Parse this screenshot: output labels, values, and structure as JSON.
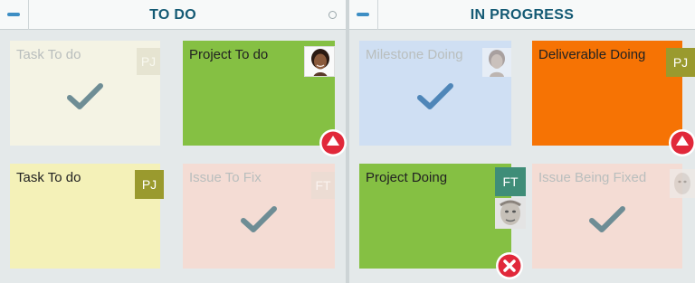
{
  "columns": [
    {
      "title": "TO DO"
    },
    {
      "title": "IN PROGRESS"
    }
  ],
  "cards": [
    {
      "title": "Task To do",
      "badge": "PJ"
    },
    {
      "title": "Project To do"
    },
    {
      "title": "Task To do",
      "badge": "PJ"
    },
    {
      "title": "Issue To Fix",
      "badge": "FT"
    },
    {
      "title": "Milestone Doing"
    },
    {
      "title": "Deliverable Doing",
      "badge": "PJ"
    },
    {
      "title": "Project Doing",
      "badge": "FT"
    },
    {
      "title": "Issue Being Fixed"
    }
  ],
  "colors": {
    "header_text": "#145a74",
    "card_faded_cream": "#f4f3e4",
    "card_green": "#85c043",
    "card_yellow": "#f4f1b8",
    "card_pink": "#f4dcd4",
    "card_blue": "#cfdff3",
    "card_orange": "#f67304",
    "badge_olive": "#9a9a2e",
    "badge_teal": "#3f8d78",
    "alert_red": "#e1283a"
  },
  "icons": [
    "collapse-icon",
    "circle-icon",
    "checkmark-icon",
    "up-arrow-icon",
    "close-icon"
  ]
}
